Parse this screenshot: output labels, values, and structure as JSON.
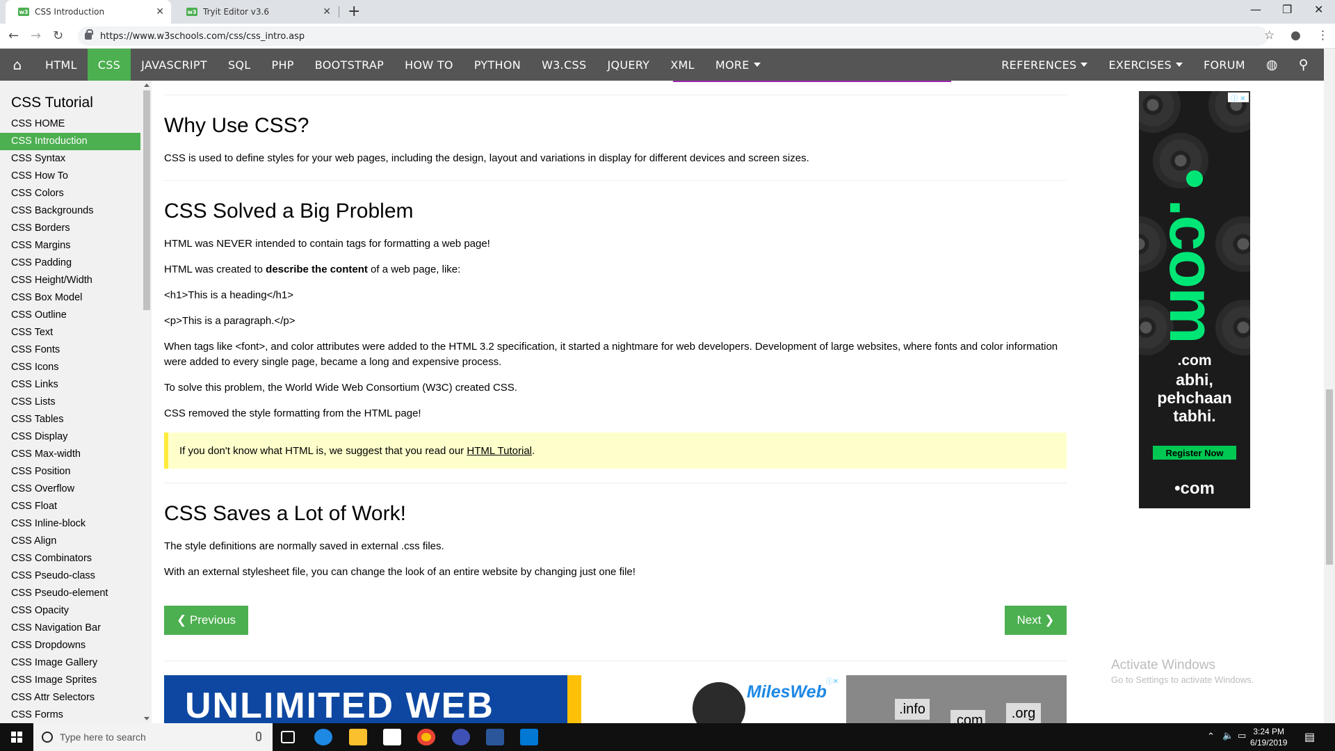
{
  "browser": {
    "tabs": [
      {
        "title": "CSS Introduction",
        "active": true
      },
      {
        "title": "Tryit Editor v3.6",
        "active": false
      }
    ],
    "url": "https://www.w3schools.com/css/css_intro.asp"
  },
  "topnav": {
    "items": [
      "HTML",
      "CSS",
      "JAVASCRIPT",
      "SQL",
      "PHP",
      "BOOTSTRAP",
      "HOW TO",
      "PYTHON",
      "W3.CSS",
      "JQUERY",
      "XML",
      "MORE"
    ],
    "active": "CSS",
    "right_items": [
      "REFERENCES",
      "EXERCISES",
      "FORUM"
    ]
  },
  "sidebar": {
    "title": "CSS Tutorial",
    "items": [
      "CSS HOME",
      "CSS Introduction",
      "CSS Syntax",
      "CSS How To",
      "CSS Colors",
      "CSS Backgrounds",
      "CSS Borders",
      "CSS Margins",
      "CSS Padding",
      "CSS Height/Width",
      "CSS Box Model",
      "CSS Outline",
      "CSS Text",
      "CSS Fonts",
      "CSS Icons",
      "CSS Links",
      "CSS Lists",
      "CSS Tables",
      "CSS Display",
      "CSS Max-width",
      "CSS Position",
      "CSS Overflow",
      "CSS Float",
      "CSS Inline-block",
      "CSS Align",
      "CSS Combinators",
      "CSS Pseudo-class",
      "CSS Pseudo-element",
      "CSS Opacity",
      "CSS Navigation Bar",
      "CSS Dropdowns",
      "CSS Image Gallery",
      "CSS Image Sprites",
      "CSS Attr Selectors",
      "CSS Forms"
    ],
    "active_index": 1
  },
  "main": {
    "why_title": "Why Use CSS?",
    "why_text": "CSS is used to define styles for your web pages, including the design, layout and variations in display for different devices and screen sizes.",
    "solved_title": "CSS Solved a Big Problem",
    "p1": "HTML was NEVER intended to contain tags for formatting a web page!",
    "p2_before": "HTML was created to ",
    "p2_bold": "describe the content",
    "p2_after": " of a web page, like:",
    "code1": "<h1>This is a heading</h1>",
    "code2": "<p>This is a paragraph.</p>",
    "p3": "When tags like <font>, and color attributes were added to the HTML 3.2 specification, it started a nightmare for web developers. Development of large websites, where fonts and color information were added to every single page, became a long and expensive process.",
    "p4": "To solve this problem, the World Wide Web Consortium (W3C) created CSS.",
    "p5": "CSS removed the style formatting from the HTML page!",
    "note_before": "If you don't know what HTML is, we suggest that you read our ",
    "note_link": "HTML Tutorial",
    "note_after": ".",
    "saves_title": "CSS Saves a Lot of Work!",
    "p6": "The style definitions are normally saved in external .css files.",
    "p7": "With an external stylesheet file, you can change the look of an entire website by changing just one file!",
    "prev_label": "❮ Previous",
    "next_label": "Next ❯"
  },
  "ads": {
    "right": {
      "big": ".com",
      "line1": ".com",
      "line2": "abhi,",
      "line3": "pehchaan",
      "line4": "tabhi.",
      "cta": "Register Now",
      "footer": "•com"
    },
    "bottom1": "UNLIMITED WEB",
    "bottom2_brand": "MilesWeb",
    "bottom3": [
      ".info",
      ".org",
      ".com"
    ]
  },
  "watermark": {
    "title": "Activate Windows",
    "subtitle": "Go to Settings to activate Windows."
  },
  "taskbar": {
    "search_placeholder": "Type here to search",
    "time": "3:24 PM",
    "date": "6/19/2019"
  },
  "colors": {
    "w3green": "#4CAF50",
    "topnav_bg": "#555555",
    "note_bg": "#ffffcc",
    "note_border": "#ffeb3b"
  }
}
